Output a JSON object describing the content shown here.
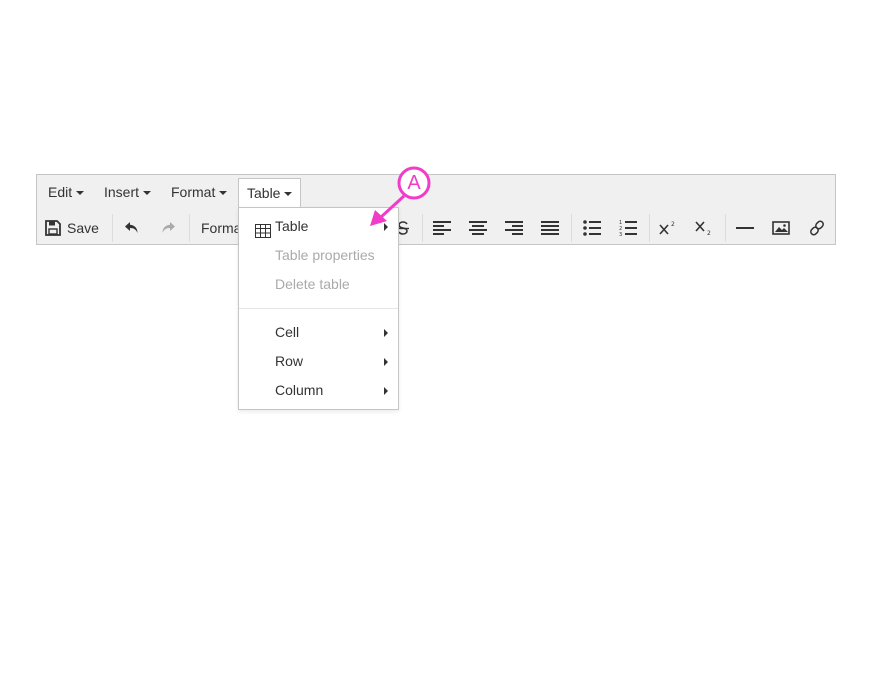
{
  "menubar": {
    "items": [
      {
        "label": "Edit"
      },
      {
        "label": "Insert"
      },
      {
        "label": "Format"
      },
      {
        "label": "Table"
      }
    ]
  },
  "toolbar": {
    "save_label": "Save",
    "format_label": "Formats",
    "icons": [
      "save-icon",
      "undo-icon",
      "redo-icon",
      "strikethrough-icon",
      "align-left-icon",
      "align-center-icon",
      "align-right-icon",
      "align-justify-icon",
      "bullet-list-icon",
      "numbered-list-icon",
      "superscript-icon",
      "subscript-icon",
      "horizontal-rule-icon",
      "image-icon",
      "link-icon"
    ]
  },
  "table_menu": {
    "items": [
      {
        "label": "Table",
        "icon": "table-grid-icon",
        "has_submenu": true,
        "disabled": false
      },
      {
        "label": "Table properties",
        "has_submenu": false,
        "disabled": true
      },
      {
        "label": "Delete table",
        "has_submenu": false,
        "disabled": true
      },
      {
        "label": "Cell",
        "has_submenu": true,
        "disabled": false
      },
      {
        "label": "Row",
        "has_submenu": true,
        "disabled": false
      },
      {
        "label": "Column",
        "has_submenu": true,
        "disabled": false
      }
    ]
  },
  "annotation": {
    "label": "A",
    "color": "#f03cc8"
  }
}
